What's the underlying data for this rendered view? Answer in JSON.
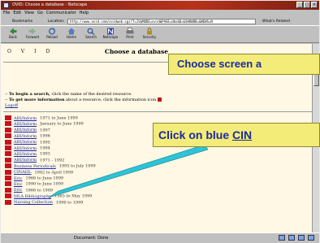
{
  "window": {
    "title": "OVID: Choose a database - Netscape",
    "controls": [
      "_",
      "□",
      "×"
    ]
  },
  "menu": [
    "File",
    "Edit",
    "View",
    "Go",
    "Communicator",
    "Help"
  ],
  "location": {
    "bookmarks_label": "Bookmarks",
    "location_label": "Location:",
    "url": "http://www.ovid.com/ovidweb.cgi?T=JS&MODE=ovid&PAGE=dbs&D=&SHOWDB=&NEWS=N",
    "related_label": "What's Related"
  },
  "toolbar": [
    {
      "label": "Back",
      "icon": "back-arrow-icon"
    },
    {
      "label": "Forward",
      "icon": "forward-arrow-icon"
    },
    {
      "label": "Reload",
      "icon": "reload-icon"
    },
    {
      "label": "Home",
      "icon": "home-icon"
    },
    {
      "label": "Search",
      "icon": "search-icon"
    },
    {
      "label": "Netscape",
      "icon": "netscape-icon"
    },
    {
      "label": "Print",
      "icon": "print-icon"
    },
    {
      "label": "Security",
      "icon": "security-icon"
    }
  ],
  "page": {
    "nav": [
      "O",
      "V",
      "I",
      "D"
    ],
    "heading": "Choose a database",
    "instruction1_bold": "To begin a search,",
    "instruction1_rest": " click the name of the desired resource.",
    "instruction2_bold": "To get more information",
    "instruction2_rest": " about a resource, click the information icon",
    "logout": "Logoff",
    "databases": [
      {
        "name": "ABI/Inform",
        "dates": "1971 to June 1999"
      },
      {
        "name": "ABI/Inform",
        "dates": "January to June 1999"
      },
      {
        "name": "ABI/Inform",
        "dates": "1997"
      },
      {
        "name": "ABI/Inform",
        "dates": "1996"
      },
      {
        "name": "ABI/Inform",
        "dates": "1995"
      },
      {
        "name": "ABI/Inform",
        "dates": "1994"
      },
      {
        "name": "ABI/Inform",
        "dates": "1993"
      },
      {
        "name": "ABI/Inform",
        "dates": "1971 - 1992"
      },
      {
        "name": "Business Periodicals",
        "dates": "1995 to July 1999"
      },
      {
        "name": "CINAHL",
        "dates": "1982 to April 1999"
      },
      {
        "name": "Eric",
        "dates": "1966 to June 1999"
      },
      {
        "name": "Eric",
        "dates": "1990 to June 1999"
      },
      {
        "name": "Eric",
        "dates": "1966 to 1989"
      },
      {
        "name": "MLA Bibliography",
        "dates": "1963 to May 1999"
      },
      {
        "name": "Nursing Collection",
        "dates": "1996 to 1999"
      }
    ]
  },
  "status": {
    "text": "Document: Done"
  },
  "callouts": {
    "first": "Choose screen a",
    "second_prefix": "Click on blue ",
    "second_link": "CIN"
  }
}
